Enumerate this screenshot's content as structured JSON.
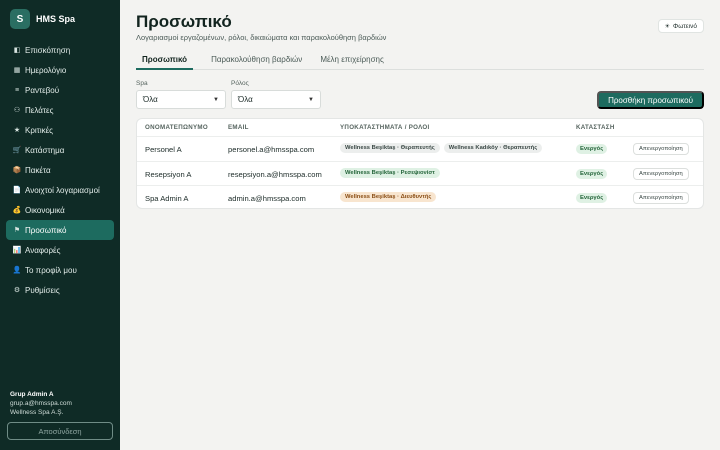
{
  "app": {
    "name": "HMS Spa",
    "logo_letter": "S"
  },
  "sidebar": {
    "items": [
      {
        "label": "Επισκόπηση",
        "icon": "overview-icon",
        "glyph": "◧"
      },
      {
        "label": "Ημερολόγιο",
        "icon": "calendar-icon",
        "glyph": "▦"
      },
      {
        "label": "Ραντεβού",
        "icon": "list-icon",
        "glyph": "≡"
      },
      {
        "label": "Πελάτες",
        "icon": "users-icon",
        "glyph": "⚇"
      },
      {
        "label": "Κριτικές",
        "icon": "star-icon",
        "glyph": "★"
      },
      {
        "label": "Κατάστημα",
        "icon": "cart-icon",
        "glyph": "🛒"
      },
      {
        "label": "Πακέτα",
        "icon": "package-icon",
        "glyph": "📦"
      },
      {
        "label": "Ανοιχτοί λογαριασμοί",
        "icon": "receipt-icon",
        "glyph": "📄"
      },
      {
        "label": "Οικονομικά",
        "icon": "money-bag-icon",
        "glyph": "💰"
      },
      {
        "label": "Προσωπικό",
        "icon": "flag-icon",
        "glyph": "⚑"
      },
      {
        "label": "Αναφορές",
        "icon": "chart-icon",
        "glyph": "📊"
      },
      {
        "label": "Το προφίλ μου",
        "icon": "profile-icon",
        "glyph": "👤"
      },
      {
        "label": "Ρυθμίσεις",
        "icon": "gear-icon",
        "glyph": "⚙"
      }
    ],
    "active_index": 9,
    "user": {
      "name": "Grup Admin A",
      "email": "grup.a@hmsspa.com",
      "company": "Wellness Spa A.Ş."
    },
    "logout_label": "Αποσύνδεση"
  },
  "header": {
    "title": "Προσωπικό",
    "subtitle": "Λογαριασμοί εργαζομένων, ρόλοι, δικαιώματα και παρακολούθηση βαρδιών",
    "theme_label": "Φωτεινό",
    "theme_glyph": "☀"
  },
  "tabs": [
    {
      "label": "Προσωπικό"
    },
    {
      "label": "Παρακολούθηση βαρδιών"
    },
    {
      "label": "Μέλη επιχείρησης"
    }
  ],
  "filters": {
    "spa": {
      "label": "Spa",
      "value": "Όλα"
    },
    "role": {
      "label": "Ρόλος",
      "value": "Όλα"
    }
  },
  "add_button_label": "Προσθήκη προσωπικού",
  "table": {
    "headers": {
      "name": "ΟΝΟΜΑΤΕΠΩΝΥΜΟ",
      "email": "EMAIL",
      "branches": "ΥΠΟΚΑΤΑΣΤΗΜΑΤΑ / ΡΟΛΟΙ",
      "status": "ΚΑΤΑΣΤΑΣΗ"
    },
    "rows": [
      {
        "name": "Personel A",
        "email": "personel.a@hmsspa.com",
        "chips": [
          {
            "label": "Wellness Beşiktaş · Θεραπευτής",
            "color": "#eceeed"
          },
          {
            "label": "Wellness Kadıköy · Θεραπευτής",
            "color": "#eceeed"
          }
        ],
        "status": "Ενεργός",
        "action": "Απενεργοποίηση"
      },
      {
        "name": "Resepsiyon A",
        "email": "resepsiyon.a@hmsspa.com",
        "chips": [
          {
            "label": "Wellness Beşiktaş · Ρεσεψιονίστ",
            "color": "#dff1e4"
          }
        ],
        "status": "Ενεργός",
        "action": "Απενεργοποίηση"
      },
      {
        "name": "Spa Admin A",
        "email": "admin.a@hmsspa.com",
        "chips": [
          {
            "label": "Wellness Beşiktaş · Διευθυντής",
            "color": "#f8e5cf"
          }
        ],
        "status": "Ενεργός",
        "action": "Απενεργοποίηση"
      }
    ]
  },
  "colors": {
    "sidebar_bg": "#0f2b26",
    "accent": "#1d6b5f",
    "page_bg": "#f3f3f1"
  }
}
